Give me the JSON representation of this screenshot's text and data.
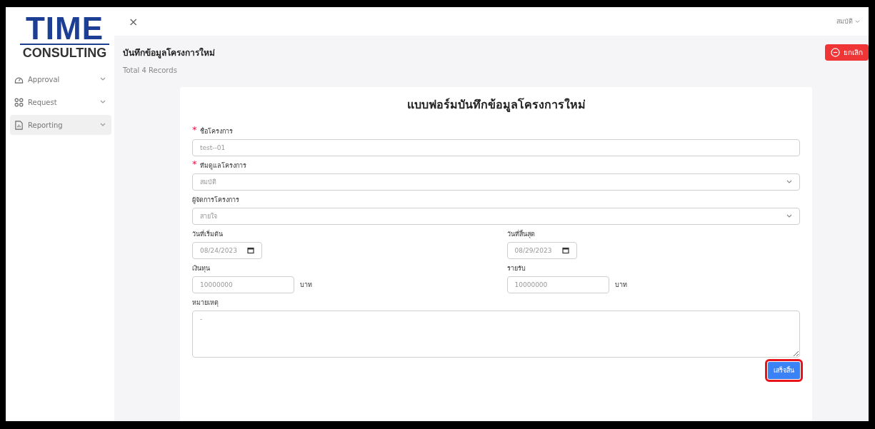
{
  "logo": {
    "title": "TIME",
    "subtitle": "CONSULTING"
  },
  "sidebar": {
    "items": [
      {
        "label": "Approval",
        "selected": false
      },
      {
        "label": "Request",
        "selected": false
      },
      {
        "label": "Reporting",
        "selected": true
      }
    ]
  },
  "topbar": {
    "close": "×",
    "user": "สมบัติ"
  },
  "header": {
    "title": "บันทึกข้อมูลโครงการใหม่",
    "cancel_button": "ยกเลิก",
    "records": "Total 4 Records"
  },
  "form": {
    "title": "แบบฟอร์มบันทึกข้อมูลโครงการใหม่",
    "project_name": {
      "required_mark": "*",
      "label": "ชื่อโครงการ",
      "value": "test--01"
    },
    "team": {
      "required_mark": "*",
      "label": "ทีมดูแลโครงการ",
      "value": "สมบัติ"
    },
    "manager": {
      "label": "ผู้จัดการโครงการ",
      "value": "สายใจ"
    },
    "start_date": {
      "label": "วันที่เริ่มต้น",
      "value": "08/24/2023"
    },
    "end_date": {
      "label": "วันที่สิ้นสุด",
      "value": "08/29/2023"
    },
    "budget": {
      "label": "เงินทุน",
      "value": "10000000",
      "unit": "บาท"
    },
    "income": {
      "label": "รายรับ",
      "value": "10000000",
      "unit": "บาท"
    },
    "note": {
      "label": "หมายเหตุ",
      "value": "-"
    },
    "submit_button": {
      "label": "เสร็จสิ้น",
      "highlighted": true
    }
  }
}
